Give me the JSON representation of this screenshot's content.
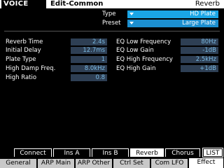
{
  "header": {
    "mode": "VOICE",
    "page": "Edit-Common",
    "category": "Reverb"
  },
  "type": {
    "label": "Type",
    "value": "HD Plate"
  },
  "preset": {
    "label": "Preset",
    "value": "Large Plate"
  },
  "params_left": [
    {
      "label": "Reverb Time",
      "value": "2.4s"
    },
    {
      "label": "Initial Delay",
      "value": "12.7ms"
    },
    {
      "label": "Plate Type",
      "value": "1"
    },
    {
      "label": "High Damp Freq.",
      "value": "8.0kHz"
    },
    {
      "label": "High Ratio",
      "value": "0.8"
    }
  ],
  "params_right": [
    {
      "label": "EQ Low Frequency",
      "value": "80Hz"
    },
    {
      "label": "EQ Low Gain",
      "value": "-1dB"
    },
    {
      "label": "EQ High Frequency",
      "value": "2.5kHz"
    },
    {
      "label": "EQ High Gain",
      "value": "+1dB"
    }
  ],
  "subtabs": [
    "Connect",
    "Ins A",
    "Ins B",
    "Reverb",
    "Chorus",
    "LIST"
  ],
  "subtabs_active": "Reverb",
  "tabs": [
    "General",
    "ARP Main",
    "ARP Other",
    "Ctrl Set",
    "Com LFO",
    "Effect"
  ],
  "tabs_active": "Effect"
}
